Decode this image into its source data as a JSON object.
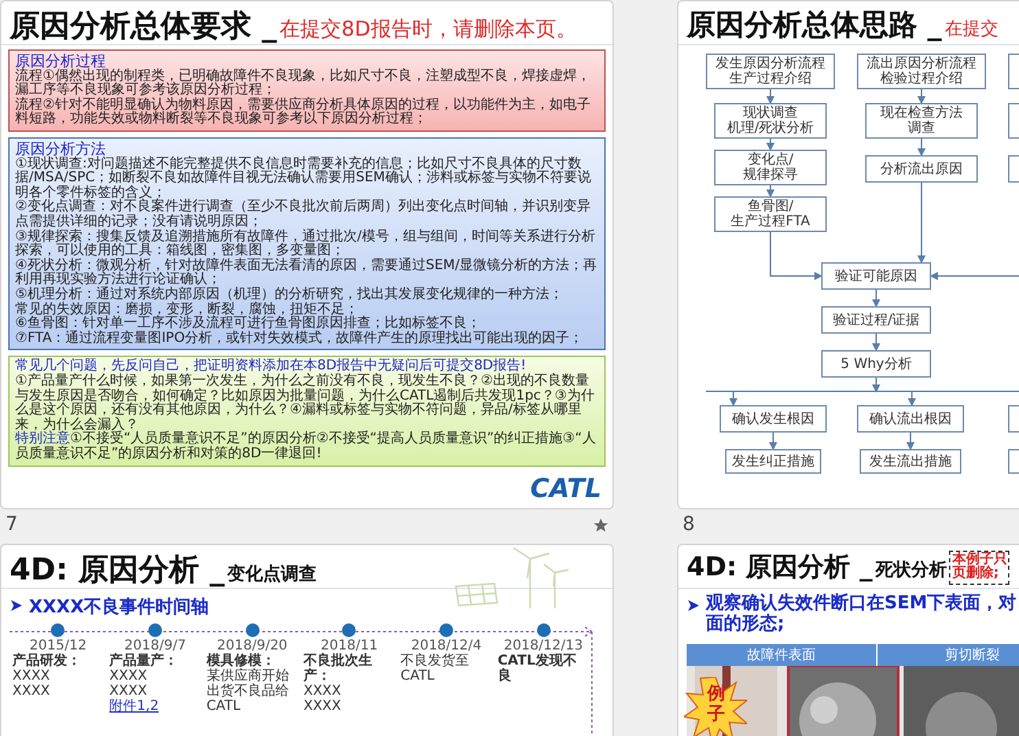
{
  "slides": [
    {
      "kind": "requirements",
      "number": "7",
      "animated": true,
      "title": "原因分析总体要求 _",
      "note": "在提交8D报告时，请删除本页。",
      "logo": "CATL",
      "sections": [
        {
          "kind": "process",
          "heading": "原因分析过程",
          "paragraphs": [
            {
              "text": "流程①偶然出现的制程类，已明确故障件不良现象，比如尺寸不良，注塑成型不良，焊接虚焊，漏工序等不良现象可参考该原因分析过程；"
            },
            {
              "text": "流程②针对不能明显确认为物料原因，需要供应商分析具体原因的过程，以功能件为主，如电子料短路，功能失效或物料断裂等不良现象可参考以下原因分析过程；"
            }
          ]
        },
        {
          "kind": "methods",
          "heading": "原因分析方法",
          "paragraphs": [
            {
              "text": "①现状调查:对问题描述不能完整提供不良信息时需要补充的信息；比如尺寸不良具体的尺寸数据/MSA/SPC；如断裂不良如故障件目视无法确认需要用SEM确认；涉料或标签与实物不符要说明各个零件标签的含义；"
            },
            {
              "text": "②变化点调查：对不良案件进行调查（至少不良批次前后两周）列出变化点时间轴，并识别变异点需提供详细的记录；没有请说明原因；"
            },
            {
              "text": "③规律探索：搜集反馈及追溯措施所有故障件，通过批次/模号，组与组间，时间等关系进行分析探索，可以使用的工具：箱线图，密集图，多变量图；"
            },
            {
              "text": "④死状分析：微观分析，针对故障件表面无法看清的原因，需要通过SEM/显微镜分析的方法；再利用再现实验方法进行论证确认；"
            },
            {
              "text": "⑤机理分析：通过对系统内部原因（机理）的分析研究，找出其发展变化规律的一种方法；"
            },
            {
              "text": "常见的失效原因：磨损，变形，断裂，腐蚀，扭矩不足；"
            },
            {
              "text": "⑥鱼骨图：针对单一工序不涉及流程可进行鱼骨图原因排查；比如标签不良；"
            },
            {
              "text": "⑦FTA：通过流程变量图IPO分析，或针对失效模式，故障件产生的原理找出可能出现的因子；"
            }
          ]
        },
        {
          "kind": "checklist",
          "heading": "常见几个问题，先反问自己，把证明资料添加在本8D报告中无疑问后可提交8D报告!",
          "paragraphs": [
            {
              "text": "①产品量产什么时候，如果第一次发生，为什么之前没有不良，现发生不良？②出现的不良数量与发生原因是否吻合，如何确定？比如原因为批量问题，为什么CATL遏制后共发现1pc？③为什么是这个原因，还有没有其他原因，为什么？④漏料或标签与实物不符问题，异品/标签从哪里来，为什么会漏入？"
            },
            {
              "lead": "特别注意",
              "text": "①不接受“人员质量意识不足”的原因分析②不接受“提高人员质量意识”的纠正措施③“人员质量意识不足”的原因分析和对策的8D一律退回!"
            }
          ]
        }
      ]
    },
    {
      "kind": "flowchart",
      "number": "8",
      "title": "原因分析总体思路 _",
      "note": "在提交",
      "nodes": [
        {
          "lines": [
            "发生原因分析流程",
            "生产过程介绍"
          ]
        },
        {
          "lines": [
            "流出原因分析流程",
            "检验过程介绍"
          ]
        },
        {
          "lines": [
            "现状调查",
            "机理/死状分析"
          ]
        },
        {
          "lines": [
            "现在检查方法",
            "调查"
          ]
        },
        {
          "lines": [
            "变化点/",
            "规律探寻"
          ]
        },
        {
          "lines": [
            "分析流出原因"
          ]
        },
        {
          "lines": [
            "鱼骨图/",
            "生产过程FTA"
          ]
        },
        {
          "lines": [
            "验证可能原因"
          ]
        },
        {
          "lines": [
            "验证过程/证据"
          ]
        },
        {
          "lines": [
            "5 Why分析"
          ]
        },
        {
          "lines": [
            "确认发生根因"
          ]
        },
        {
          "lines": [
            "确认流出根因"
          ]
        },
        {
          "lines": [
            "发生纠正措施"
          ]
        },
        {
          "lines": [
            "发生流出措施"
          ]
        }
      ]
    },
    {
      "kind": "timeline",
      "title": "4D: 原因分析 _",
      "note": "变化点调查",
      "heading": "XXXX不良事件时间轴",
      "events": [
        {
          "date": "2015/12",
          "label": "产品研发：",
          "lines": [
            "XXXX",
            "XXXX"
          ]
        },
        {
          "date": "2018/9/7",
          "label": "产品量产：",
          "lines": [
            "XXXX",
            "XXXX"
          ],
          "link": "附件1,2"
        },
        {
          "date": "2018/9/20",
          "label": "模具修模：",
          "lines": [
            "某供应商开始出货不良品给CATL"
          ]
        },
        {
          "date": "2018/11",
          "label": "不良批次生产：",
          "lines": [
            "XXXX",
            "XXXX"
          ]
        },
        {
          "date": "2018/12/4",
          "lines": [
            "不良发货至CATL"
          ]
        },
        {
          "date": "2018/12/13",
          "label": "CATL发现不良"
        }
      ]
    },
    {
      "kind": "photos",
      "title": "4D: 原因分析 _",
      "note": "死状分析",
      "warning": [
        "本例子只",
        "页删除;"
      ],
      "heading": [
        "观察确认失效件断口在SEM下表面，对",
        "面的形态;"
      ],
      "badge": [
        "例",
        "子"
      ],
      "columns": [
        "故障件表面",
        "剪切断裂"
      ]
    }
  ]
}
